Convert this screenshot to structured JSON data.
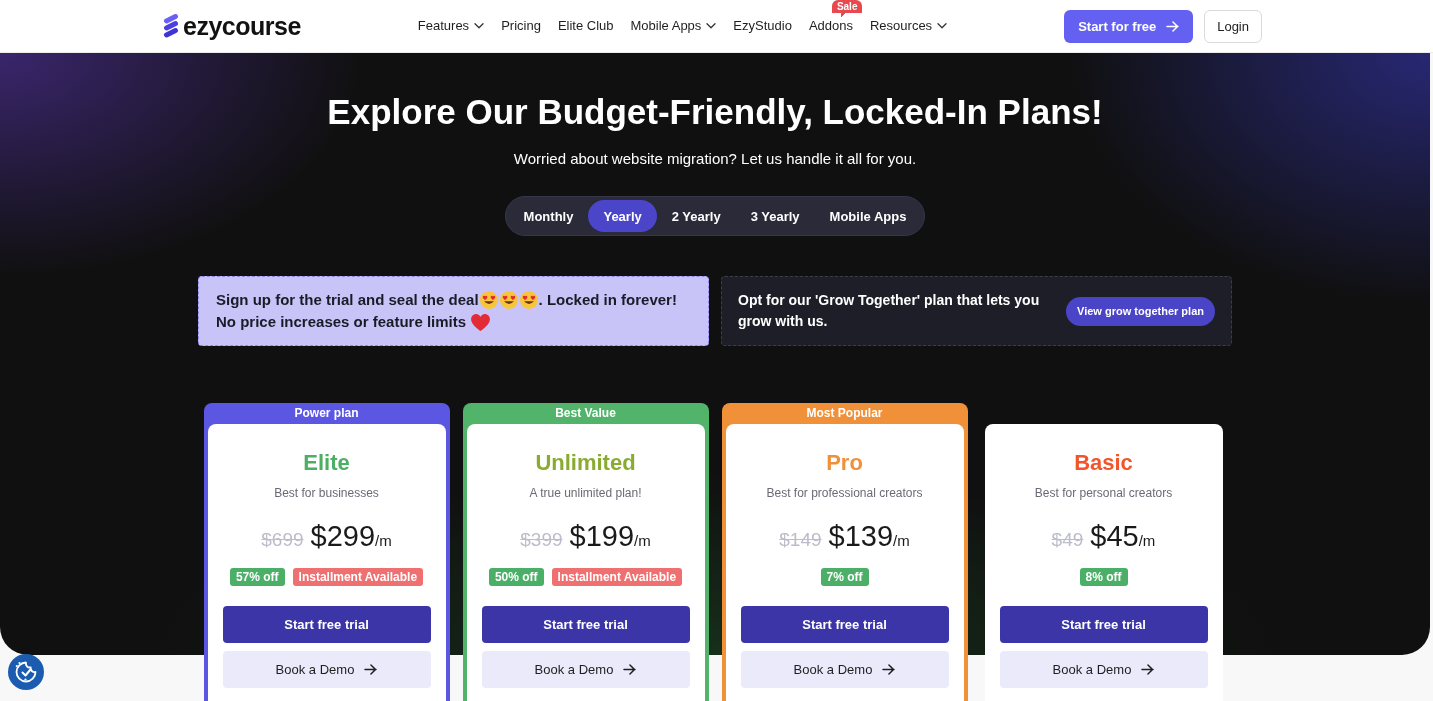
{
  "header": {
    "logo": {
      "text": "ezycourse"
    },
    "nav": [
      {
        "label": "Features",
        "dropdown": true
      },
      {
        "label": "Pricing",
        "dropdown": false
      },
      {
        "label": "Elite Club",
        "dropdown": false
      },
      {
        "label": "Mobile Apps",
        "dropdown": true
      },
      {
        "label": "EzyStudio",
        "dropdown": false
      },
      {
        "label": "Addons",
        "dropdown": false,
        "badge": "Sale"
      },
      {
        "label": "Resources",
        "dropdown": true
      }
    ],
    "actions": [
      {
        "label": "Start for free",
        "kind": "primary"
      },
      {
        "label": "Login",
        "kind": "outline"
      }
    ]
  },
  "hero": {
    "title": "Explore Our Budget-Friendly, Locked-In Plans!",
    "subtitle": "Worried about website migration? Let us handle it all for you.",
    "billing_tabs": [
      {
        "label": "Monthly",
        "selected": false
      },
      {
        "label": "Yearly",
        "selected": true
      },
      {
        "label": "2 Yearly",
        "selected": false
      },
      {
        "label": "3 Yearly",
        "selected": false
      },
      {
        "label": "Mobile Apps",
        "selected": false
      }
    ],
    "trial_banner": {
      "lines": [
        [
          {
            "kind": "text",
            "text": "Sign up for the trial and seal the deal"
          },
          {
            "kind": "hearteyes"
          },
          {
            "kind": "hearteyes"
          },
          {
            "kind": "hearteyes"
          },
          {
            "kind": "text",
            "text": ". Locked in forever!"
          }
        ],
        [
          {
            "kind": "text",
            "text": "No price increases or feature limits"
          },
          {
            "kind": "heart"
          }
        ]
      ]
    },
    "grow_banner": {
      "text": "Opt for our 'Grow Together' plan that lets you grow with us.",
      "button": "View grow together plan"
    }
  },
  "plans": [
    {
      "ribbon": {
        "label": "Power plan",
        "color": "#5c57e3"
      },
      "name": "Elite",
      "color": "#4caf63",
      "tagline": "Best for businesses",
      "old_price": "$699",
      "price": "$299",
      "period": "/m",
      "badges": [
        {
          "kind": "discount",
          "label": "57% off"
        },
        {
          "kind": "installment",
          "label": "Installment Available"
        }
      ],
      "primary_button": "Start free trial",
      "secondary_button": "Book a Demo"
    },
    {
      "ribbon": {
        "label": "Best Value",
        "color": "#52b36b"
      },
      "name": "Unlimited",
      "color": "#8aab32",
      "tagline": "A true unlimited plan!",
      "old_price": "$399",
      "price": "$199",
      "period": "/m",
      "badges": [
        {
          "kind": "discount",
          "label": "50% off"
        },
        {
          "kind": "installment",
          "label": "Installment Available"
        }
      ],
      "primary_button": "Start free trial",
      "secondary_button": "Book a Demo"
    },
    {
      "ribbon": {
        "label": "Most Popular",
        "color": "#f0913a"
      },
      "name": "Pro",
      "color": "#f0913a",
      "tagline": "Best for professional creators",
      "old_price": "$149",
      "price": "$139",
      "period": "/m",
      "badges": [
        {
          "kind": "discount",
          "label": "7% off"
        }
      ],
      "primary_button": "Start free trial",
      "secondary_button": "Book a Demo"
    },
    {
      "name": "Basic",
      "color": "#f2552c",
      "tagline": "Best for personal creators",
      "old_price": "$49",
      "price": "$45",
      "period": "/m",
      "badges": [
        {
          "kind": "discount",
          "label": "8% off"
        }
      ],
      "primary_button": "Start free trial",
      "secondary_button": "Book a Demo"
    }
  ]
}
